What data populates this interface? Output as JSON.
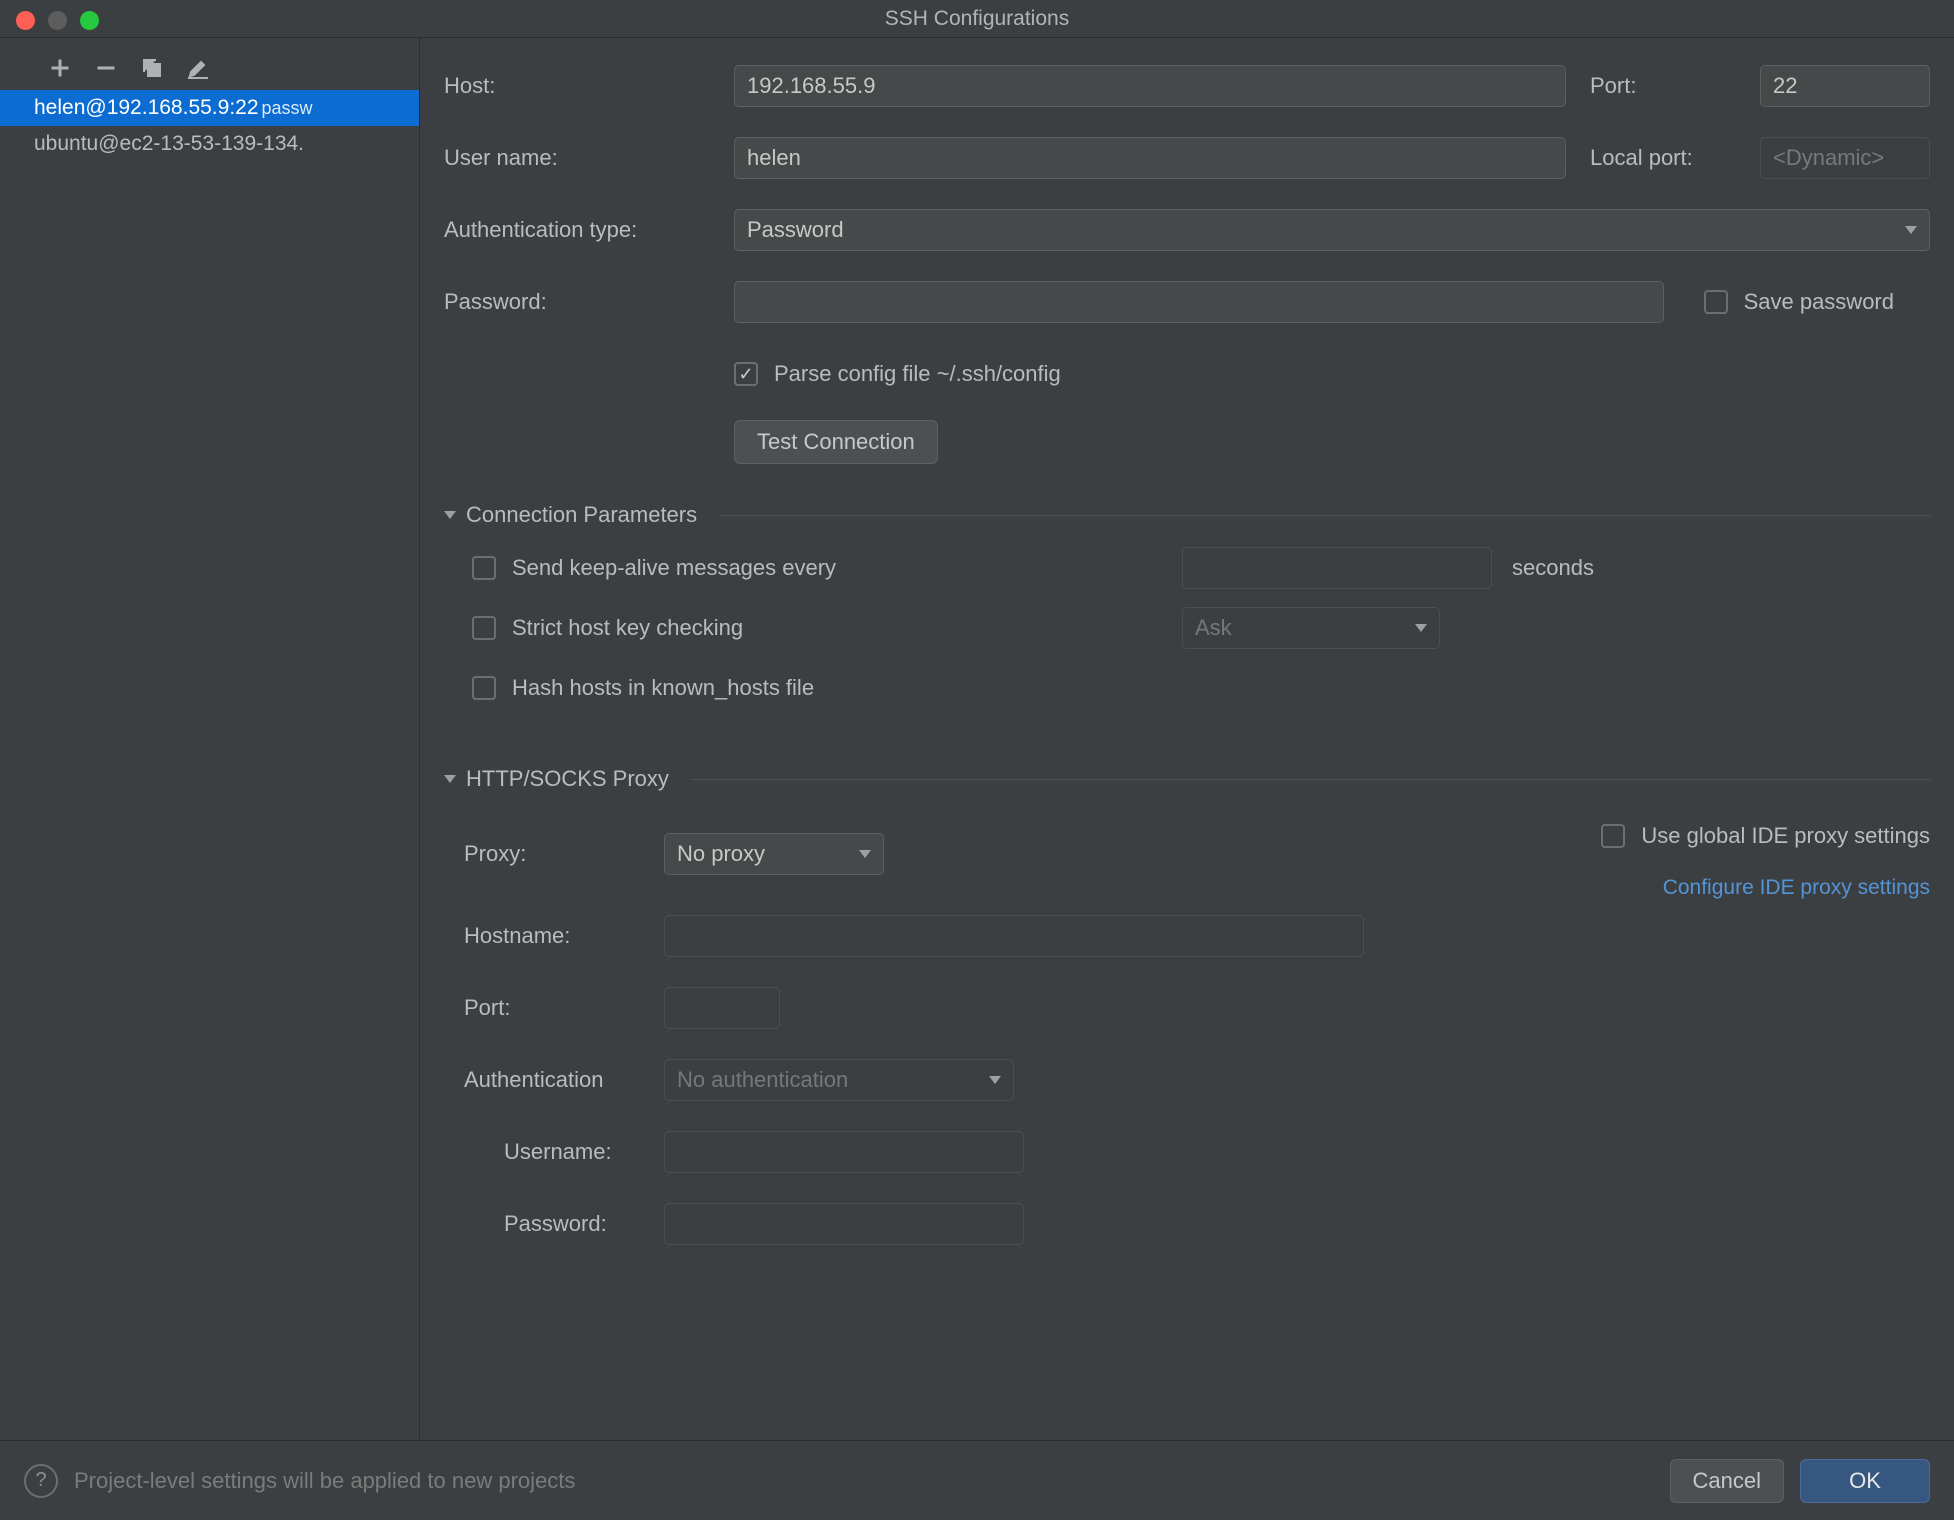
{
  "window": {
    "title": "SSH Configurations"
  },
  "sidebar": {
    "items": [
      {
        "label": "helen@192.168.55.9:22",
        "suffix": "passw",
        "selected": true
      },
      {
        "label": "ubuntu@ec2-13-53-139-134.",
        "suffix": "",
        "selected": false
      }
    ]
  },
  "form": {
    "host_label": "Host:",
    "host_value": "192.168.55.9",
    "port_label": "Port:",
    "port_value": "22",
    "user_label": "User name:",
    "user_value": "helen",
    "localport_label": "Local port:",
    "localport_placeholder": "<Dynamic>",
    "authtype_label": "Authentication type:",
    "authtype_value": "Password",
    "password_label": "Password:",
    "password_value": "",
    "save_password_label": "Save password",
    "parse_config_label": "Parse config file ~/.ssh/config",
    "parse_config_checked": true,
    "test_connection_label": "Test Connection"
  },
  "connparams": {
    "title": "Connection Parameters",
    "keepalive_label": "Send keep-alive messages every",
    "keepalive_value": "",
    "keepalive_suffix": "seconds",
    "stricthost_label": "Strict host key checking",
    "stricthost_value": "Ask",
    "hashhosts_label": "Hash hosts in known_hosts file"
  },
  "proxy": {
    "title": "HTTP/SOCKS Proxy",
    "proxy_label": "Proxy:",
    "proxy_value": "No proxy",
    "use_global_label": "Use global IDE proxy settings",
    "configure_link": "Configure IDE proxy settings",
    "hostname_label": "Hostname:",
    "port_label": "Port:",
    "auth_label": "Authentication",
    "auth_value": "No authentication",
    "username_label": "Username:",
    "password_label": "Password:"
  },
  "footer": {
    "help_text": "Project-level settings will be applied to new projects",
    "cancel": "Cancel",
    "ok": "OK"
  }
}
